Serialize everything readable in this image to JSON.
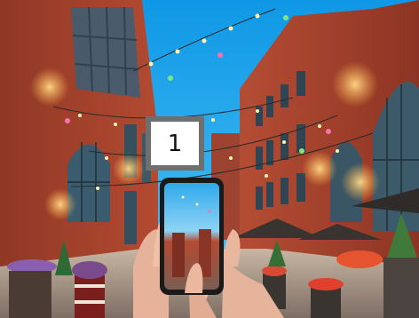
{
  "badge": {
    "label": "1"
  },
  "colors": {
    "sky_top": "#16a0ea",
    "sky_bottom": "#4dc3f5",
    "brick": "#a8432f",
    "brick_dark": "#6f2b22",
    "lamp_glow": "#ffcb66",
    "pavement": "#9e8f82"
  }
}
